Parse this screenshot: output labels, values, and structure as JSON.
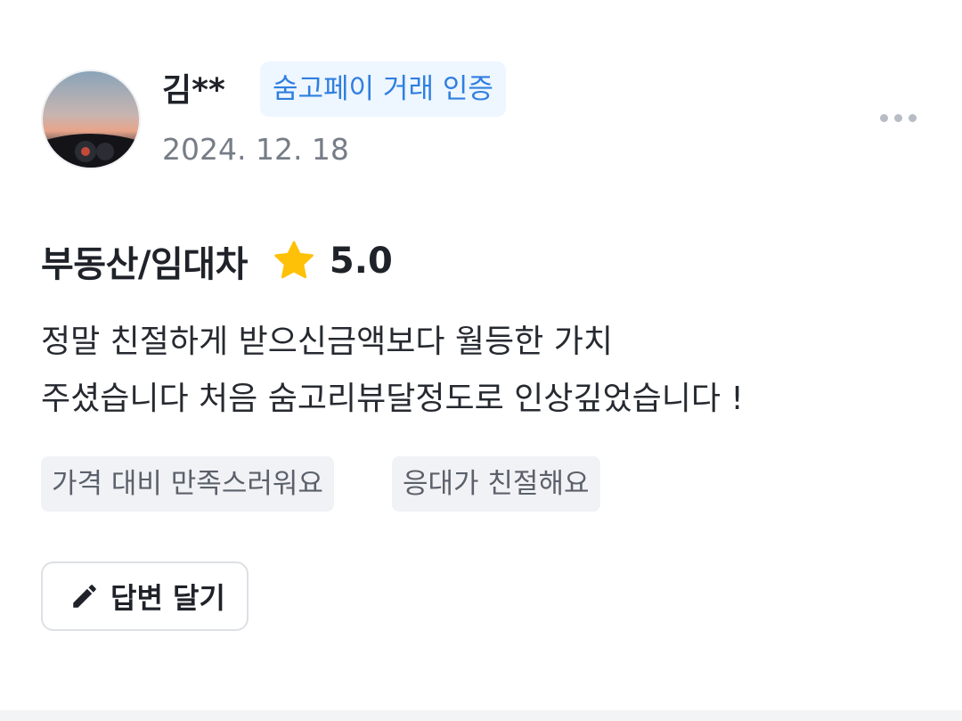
{
  "reviewer": {
    "name": "김**",
    "badge": "숨고페이 거래 인증",
    "date": "2024. 12. 18"
  },
  "review": {
    "service": "부동산/임대차",
    "rating": "5.0",
    "text_lines": [
      "정말 친절하게 받으신금액보다 월등한 가치",
      "주셨습니다 처음 숨고리뷰달정도로 인상깊었습니다 !"
    ],
    "tags": [
      "가격 대비 만족스러워요",
      "응대가 친절해요"
    ]
  },
  "actions": {
    "more_icon": "more-horizontal-icon",
    "reply_label": "답변 달기",
    "reply_icon": "pencil-icon"
  },
  "colors": {
    "badge_text": "#2f7fe0",
    "badge_bg": "#eef6ff",
    "star": "#ffc107",
    "date_text": "#777d87",
    "tag_bg": "#f1f2f5"
  }
}
